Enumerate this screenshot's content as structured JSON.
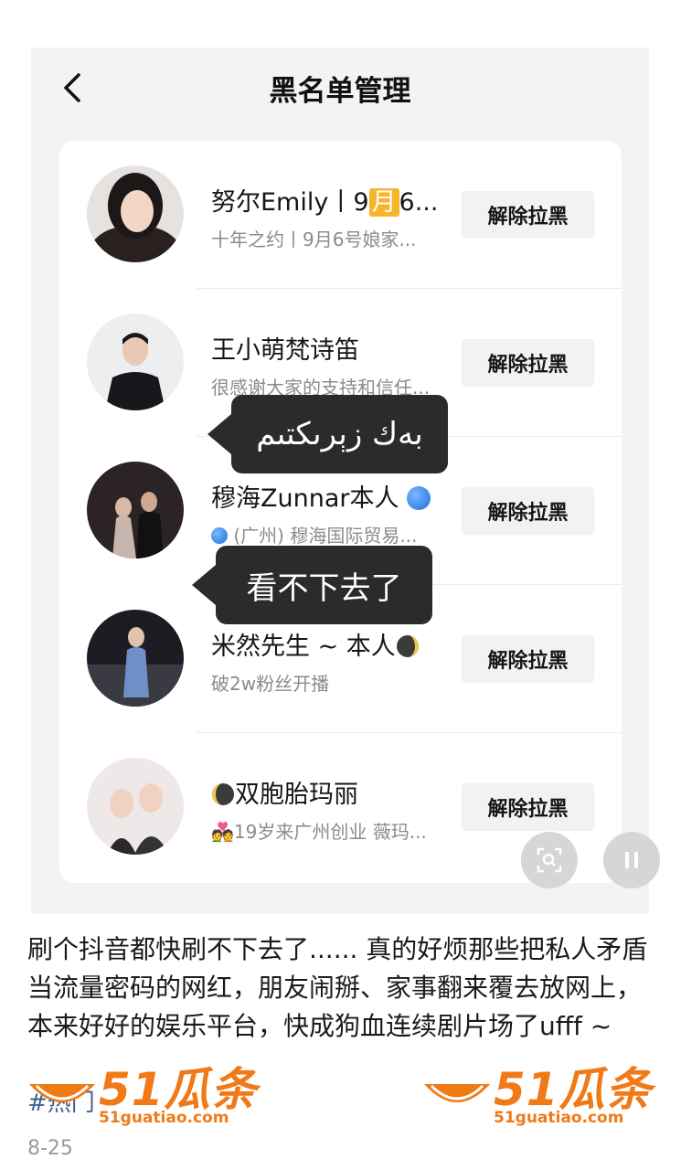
{
  "header": {
    "title": "黑名单管理",
    "back_icon": "chevron-left-icon"
  },
  "list": [
    {
      "name_prefix": "努尔Emily丨9",
      "name_highlight": "月",
      "name_suffix": "6...",
      "subtitle": "十年之约丨9月6号娘家...",
      "action": "解除拉黑"
    },
    {
      "name": "王小萌梵诗笛",
      "subtitle": "很感谢大家的支持和信任...",
      "action": "解除拉黑"
    },
    {
      "name": "穆海Zunnar本人",
      "subtitle": "(广州) 穆海国际贸易...",
      "action": "解除拉黑"
    },
    {
      "name": "米然先生 ~ 本人",
      "subtitle": "破2w粉丝开播",
      "action": "解除拉黑"
    },
    {
      "name": "双胞胎玛丽",
      "subtitle": "19岁来广州创业  薇玛...",
      "action": "解除拉黑"
    }
  ],
  "overlays": {
    "bubble_uyghur": "بەك زېرىكتىم",
    "bubble_chinese": "看不下去了"
  },
  "controls": {
    "scan_icon": "scan-search-icon",
    "pause_icon": "pause-icon"
  },
  "post": {
    "caption": "刷个抖音都快刷不下去了...... 真的好烦那些把私人矛盾当流量密码的网红，朋友闹掰、家事翻来覆去放网上，本来好好的娱乐平台，快成狗血连续剧片场了ufff ~",
    "hashtag": "#热门",
    "date": "8-25"
  },
  "watermark": {
    "brand": "51瓜条",
    "url": "51guatiao.com"
  },
  "colors": {
    "accent": "#f7b528",
    "watermark": "#f07a15",
    "bubble": "#2b2b2b"
  }
}
